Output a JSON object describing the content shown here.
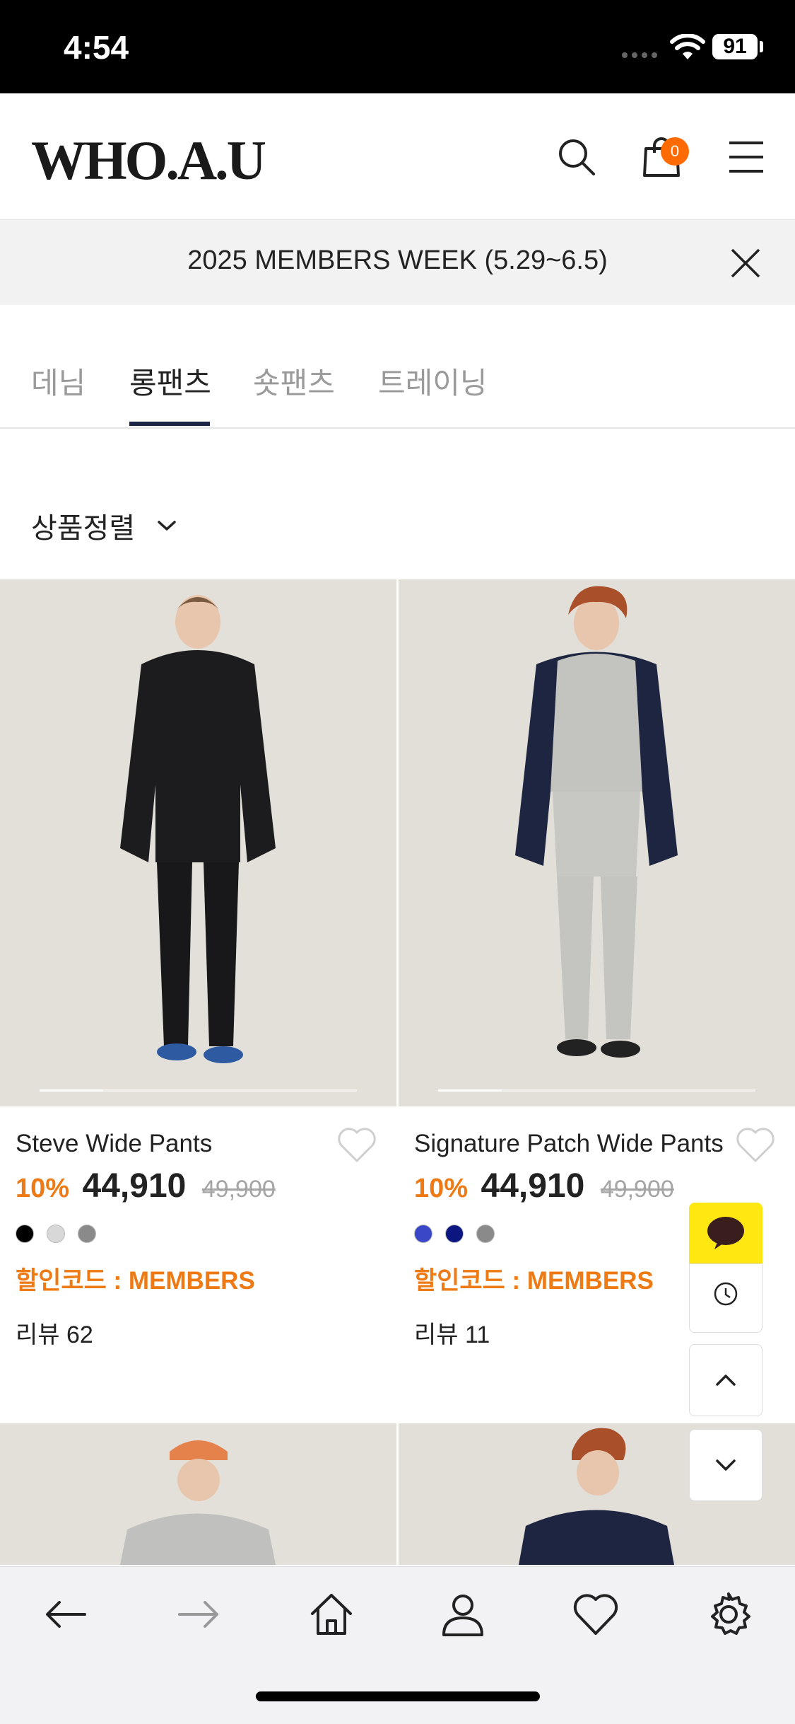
{
  "status_bar": {
    "time": "4:54",
    "battery": "91"
  },
  "header": {
    "logo": "WHO.A.U",
    "cart_count": "0",
    "icons": [
      "search-icon",
      "shopping-bag-icon",
      "hamburger-menu-icon"
    ]
  },
  "banner": {
    "text": "2025 MEMBERS WEEK (5.29~6.5)"
  },
  "tabs": [
    {
      "label": "데님",
      "active": false
    },
    {
      "label": "롱팬츠",
      "active": true
    },
    {
      "label": "숏팬츠",
      "active": false
    },
    {
      "label": "트레이닝",
      "active": false
    }
  ],
  "sort": {
    "label": "상품정렬"
  },
  "products": [
    {
      "name": "Steve Wide Pants",
      "discount": "10%",
      "price": "44,910",
      "original_price": "49,900",
      "swatches": [
        "#000000",
        "#d8d8d8",
        "#8a8a8a"
      ],
      "code": "할인코드 : MEMBERS",
      "review": "리뷰 62"
    },
    {
      "name": "Signature Patch Wide Pants",
      "discount": "10%",
      "price": "44,910",
      "original_price": "49,900",
      "swatches": [
        "#3a47c6",
        "#0c1680",
        "#8a8a8a"
      ],
      "code": "할인코드 : MEMBERS",
      "review": "리뷰 11"
    }
  ],
  "floating": {
    "kakao_label": "KAKAO"
  },
  "colors": {
    "accent": "#ee7a15",
    "tab_underline": "#1b2444",
    "badge": "#ff6b00",
    "kakao": "#ffe812"
  }
}
